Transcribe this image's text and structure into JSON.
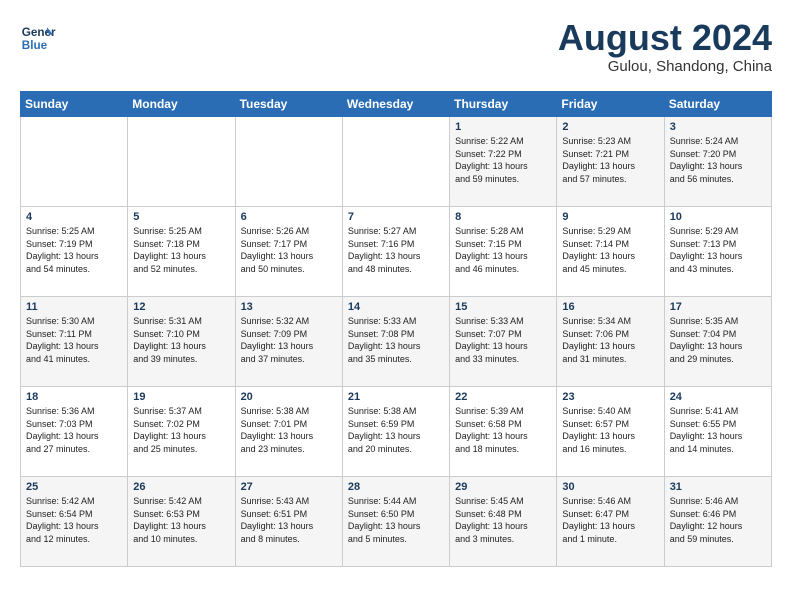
{
  "header": {
    "logo_line1": "General",
    "logo_line2": "Blue",
    "month": "August 2024",
    "location": "Gulou, Shandong, China"
  },
  "weekdays": [
    "Sunday",
    "Monday",
    "Tuesday",
    "Wednesday",
    "Thursday",
    "Friday",
    "Saturday"
  ],
  "rows": [
    [
      {
        "day": "",
        "info": ""
      },
      {
        "day": "",
        "info": ""
      },
      {
        "day": "",
        "info": ""
      },
      {
        "day": "",
        "info": ""
      },
      {
        "day": "1",
        "info": "Sunrise: 5:22 AM\nSunset: 7:22 PM\nDaylight: 13 hours\nand 59 minutes."
      },
      {
        "day": "2",
        "info": "Sunrise: 5:23 AM\nSunset: 7:21 PM\nDaylight: 13 hours\nand 57 minutes."
      },
      {
        "day": "3",
        "info": "Sunrise: 5:24 AM\nSunset: 7:20 PM\nDaylight: 13 hours\nand 56 minutes."
      }
    ],
    [
      {
        "day": "4",
        "info": "Sunrise: 5:25 AM\nSunset: 7:19 PM\nDaylight: 13 hours\nand 54 minutes."
      },
      {
        "day": "5",
        "info": "Sunrise: 5:25 AM\nSunset: 7:18 PM\nDaylight: 13 hours\nand 52 minutes."
      },
      {
        "day": "6",
        "info": "Sunrise: 5:26 AM\nSunset: 7:17 PM\nDaylight: 13 hours\nand 50 minutes."
      },
      {
        "day": "7",
        "info": "Sunrise: 5:27 AM\nSunset: 7:16 PM\nDaylight: 13 hours\nand 48 minutes."
      },
      {
        "day": "8",
        "info": "Sunrise: 5:28 AM\nSunset: 7:15 PM\nDaylight: 13 hours\nand 46 minutes."
      },
      {
        "day": "9",
        "info": "Sunrise: 5:29 AM\nSunset: 7:14 PM\nDaylight: 13 hours\nand 45 minutes."
      },
      {
        "day": "10",
        "info": "Sunrise: 5:29 AM\nSunset: 7:13 PM\nDaylight: 13 hours\nand 43 minutes."
      }
    ],
    [
      {
        "day": "11",
        "info": "Sunrise: 5:30 AM\nSunset: 7:11 PM\nDaylight: 13 hours\nand 41 minutes."
      },
      {
        "day": "12",
        "info": "Sunrise: 5:31 AM\nSunset: 7:10 PM\nDaylight: 13 hours\nand 39 minutes."
      },
      {
        "day": "13",
        "info": "Sunrise: 5:32 AM\nSunset: 7:09 PM\nDaylight: 13 hours\nand 37 minutes."
      },
      {
        "day": "14",
        "info": "Sunrise: 5:33 AM\nSunset: 7:08 PM\nDaylight: 13 hours\nand 35 minutes."
      },
      {
        "day": "15",
        "info": "Sunrise: 5:33 AM\nSunset: 7:07 PM\nDaylight: 13 hours\nand 33 minutes."
      },
      {
        "day": "16",
        "info": "Sunrise: 5:34 AM\nSunset: 7:06 PM\nDaylight: 13 hours\nand 31 minutes."
      },
      {
        "day": "17",
        "info": "Sunrise: 5:35 AM\nSunset: 7:04 PM\nDaylight: 13 hours\nand 29 minutes."
      }
    ],
    [
      {
        "day": "18",
        "info": "Sunrise: 5:36 AM\nSunset: 7:03 PM\nDaylight: 13 hours\nand 27 minutes."
      },
      {
        "day": "19",
        "info": "Sunrise: 5:37 AM\nSunset: 7:02 PM\nDaylight: 13 hours\nand 25 minutes."
      },
      {
        "day": "20",
        "info": "Sunrise: 5:38 AM\nSunset: 7:01 PM\nDaylight: 13 hours\nand 23 minutes."
      },
      {
        "day": "21",
        "info": "Sunrise: 5:38 AM\nSunset: 6:59 PM\nDaylight: 13 hours\nand 20 minutes."
      },
      {
        "day": "22",
        "info": "Sunrise: 5:39 AM\nSunset: 6:58 PM\nDaylight: 13 hours\nand 18 minutes."
      },
      {
        "day": "23",
        "info": "Sunrise: 5:40 AM\nSunset: 6:57 PM\nDaylight: 13 hours\nand 16 minutes."
      },
      {
        "day": "24",
        "info": "Sunrise: 5:41 AM\nSunset: 6:55 PM\nDaylight: 13 hours\nand 14 minutes."
      }
    ],
    [
      {
        "day": "25",
        "info": "Sunrise: 5:42 AM\nSunset: 6:54 PM\nDaylight: 13 hours\nand 12 minutes."
      },
      {
        "day": "26",
        "info": "Sunrise: 5:42 AM\nSunset: 6:53 PM\nDaylight: 13 hours\nand 10 minutes."
      },
      {
        "day": "27",
        "info": "Sunrise: 5:43 AM\nSunset: 6:51 PM\nDaylight: 13 hours\nand 8 minutes."
      },
      {
        "day": "28",
        "info": "Sunrise: 5:44 AM\nSunset: 6:50 PM\nDaylight: 13 hours\nand 5 minutes."
      },
      {
        "day": "29",
        "info": "Sunrise: 5:45 AM\nSunset: 6:48 PM\nDaylight: 13 hours\nand 3 minutes."
      },
      {
        "day": "30",
        "info": "Sunrise: 5:46 AM\nSunset: 6:47 PM\nDaylight: 13 hours\nand 1 minute."
      },
      {
        "day": "31",
        "info": "Sunrise: 5:46 AM\nSunset: 6:46 PM\nDaylight: 12 hours\nand 59 minutes."
      }
    ]
  ]
}
